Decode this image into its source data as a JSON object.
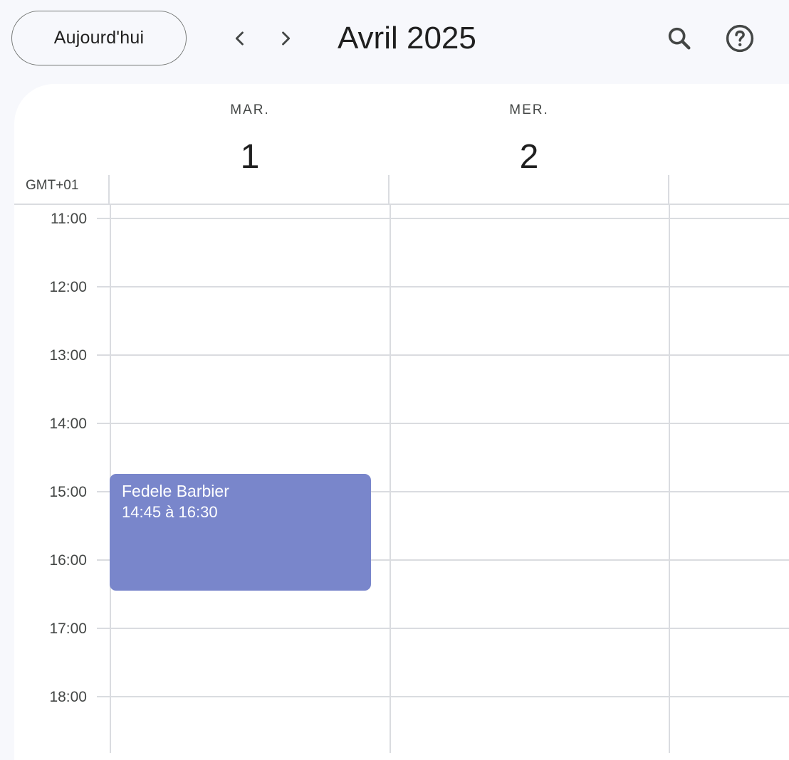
{
  "toolbar": {
    "today_label": "Aujourd'hui",
    "month_title": "Avril 2025"
  },
  "icons": {
    "prev": "chevron-left-icon",
    "next": "chevron-right-icon",
    "search": "search-icon",
    "help": "help-icon"
  },
  "timezone": "GMT+01",
  "days": [
    {
      "name": "MAR.",
      "number": "1"
    },
    {
      "name": "MER.",
      "number": "2"
    }
  ],
  "hours": [
    "11:00",
    "12:00",
    "13:00",
    "14:00",
    "15:00",
    "16:00",
    "17:00",
    "18:00"
  ],
  "event": {
    "title": "Fedele Barbier",
    "time": "14:45 à 16:30",
    "color": "#7986cb"
  },
  "colors": {
    "background": "#f7f8fc",
    "grid_line": "#dadce0"
  }
}
